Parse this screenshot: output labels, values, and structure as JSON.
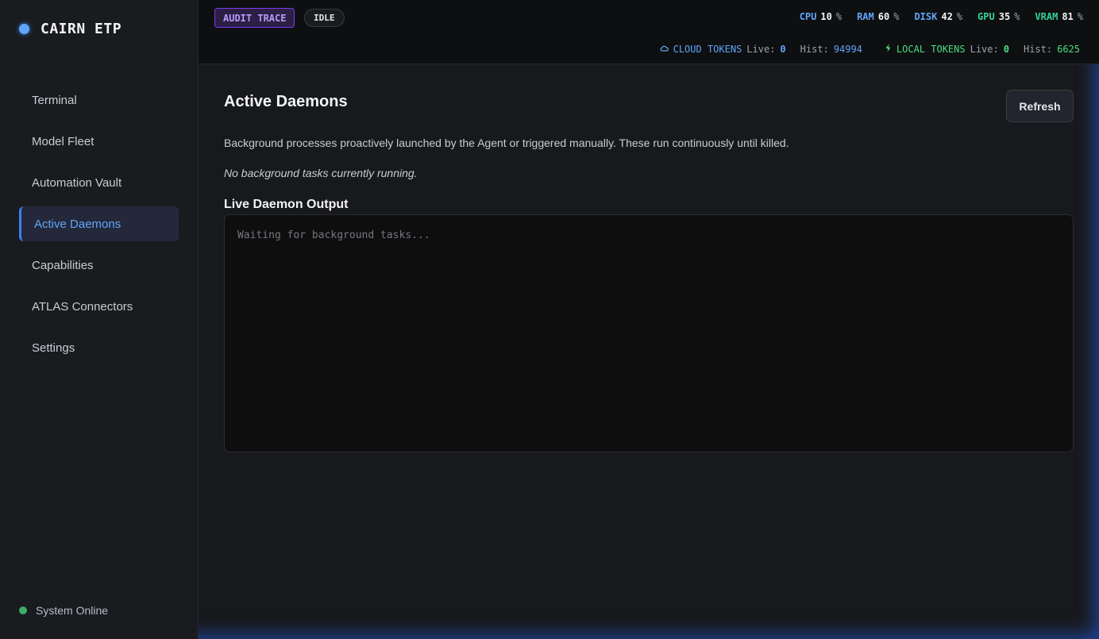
{
  "brand": {
    "name": "CAIRN ETP"
  },
  "nav": {
    "items": [
      {
        "label": "Terminal"
      },
      {
        "label": "Model Fleet"
      },
      {
        "label": "Automation Vault"
      },
      {
        "label": "Active Daemons"
      },
      {
        "label": "Capabilities"
      },
      {
        "label": "ATLAS Connectors"
      },
      {
        "label": "Settings"
      }
    ],
    "active": "Active Daemons"
  },
  "status": {
    "label": "System Online"
  },
  "topbar": {
    "audit_badge": "AUDIT TRACE",
    "state_badge": "IDLE",
    "metrics": [
      {
        "label": "CPU",
        "value": "10",
        "unit": "%",
        "color": "#60a5fa"
      },
      {
        "label": "RAM",
        "value": "60",
        "unit": "%",
        "color": "#60a5fa"
      },
      {
        "label": "DISK",
        "value": "42",
        "unit": "%",
        "color": "#60a5fa"
      },
      {
        "label": "GPU",
        "value": "35",
        "unit": "%",
        "color": "#34d399"
      },
      {
        "label": "VRAM",
        "value": "81",
        "unit": "%",
        "color": "#34d399"
      }
    ],
    "cloud": {
      "label": "CLOUD TOKENS",
      "live_label": "Live:",
      "live": "0",
      "hist_label": "Hist:",
      "hist": "94994",
      "color": "#60a5fa"
    },
    "local": {
      "label": "LOCAL TOKENS",
      "live_label": "Live:",
      "live": "0",
      "hist_label": "Hist:",
      "hist": "6625",
      "color": "#4ade80"
    }
  },
  "main": {
    "title": "Active Daemons",
    "refresh_label": "Refresh",
    "description": "Background processes proactively launched by the Agent or triggered manually. These run continuously until killed.",
    "empty_message": "No background tasks currently running.",
    "output_title": "Live Daemon Output",
    "output_placeholder": "Waiting for background tasks..."
  }
}
